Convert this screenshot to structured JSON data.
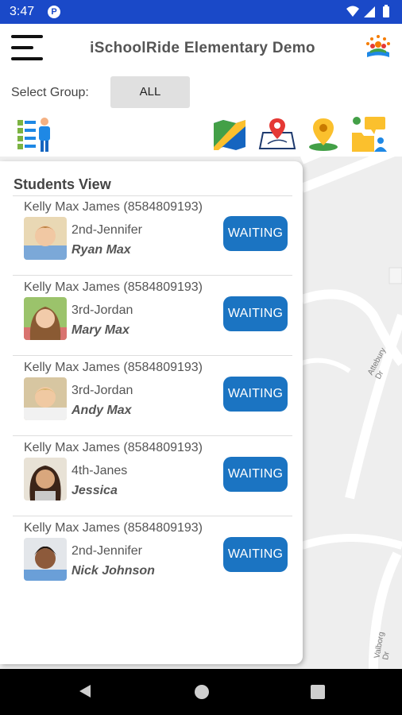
{
  "status_bar": {
    "time": "3:47",
    "notification_icon": "P"
  },
  "header": {
    "title": "iSchoolRide Elementary Demo"
  },
  "group": {
    "label": "Select Group:",
    "value": "ALL"
  },
  "toolbar": {
    "icons": [
      "student-list-icon",
      "map-icon",
      "map-location-icon",
      "location-pin-icon",
      "contacts-folder-icon"
    ]
  },
  "map": {
    "street_1": "Attebury Dr",
    "street_2": "Valborg Dr"
  },
  "panel": {
    "title": "Students View",
    "students": [
      {
        "parent": "Kelly Max James (8584809193)",
        "grade": "2nd-Jennifer",
        "name": "Ryan Max",
        "status": "WAITING"
      },
      {
        "parent": "Kelly Max James (8584809193)",
        "grade": "3rd-Jordan",
        "name": "Mary Max",
        "status": "WAITING"
      },
      {
        "parent": "Kelly Max James (8584809193)",
        "grade": "3rd-Jordan",
        "name": "Andy Max",
        "status": "WAITING"
      },
      {
        "parent": "Kelly Max James (8584809193)",
        "grade": "4th-Janes",
        "name": "Jessica",
        "status": "WAITING"
      },
      {
        "parent": "Kelly Max James (8584809193)",
        "grade": "2nd-Jennifer",
        "name": "Nick Johnson",
        "status": "WAITING"
      }
    ]
  },
  "colors": {
    "status_bar": "#1a49c8",
    "status_button": "#1b74c2"
  }
}
